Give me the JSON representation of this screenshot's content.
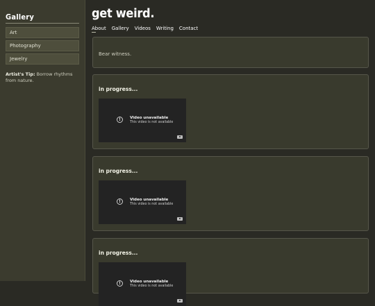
{
  "sidebar": {
    "title": "Gallery",
    "items": [
      {
        "label": "Art"
      },
      {
        "label": "Photography"
      },
      {
        "label": "Jewelry"
      }
    ],
    "tip_label": "Artist's Tip:",
    "tip_text": " Borrow rhythms from nature."
  },
  "header": {
    "title": "get weird.",
    "nav": [
      "About",
      "Gallery",
      "Videos",
      "Writing",
      "Contact"
    ]
  },
  "intro": {
    "text": "Bear witness."
  },
  "posts": [
    {
      "title": "in progress...",
      "video_title": "Video unavailable",
      "video_sub": "This video is not available"
    },
    {
      "title": "in progress...",
      "video_title": "Video unavailable",
      "video_sub": "This video is not available"
    },
    {
      "title": "in progress...",
      "video_title": "Video unavailable",
      "video_sub": "This video is not available"
    }
  ],
  "icons": {
    "error": "exclamation-circle-icon",
    "youtube": "youtube-logo-icon"
  }
}
